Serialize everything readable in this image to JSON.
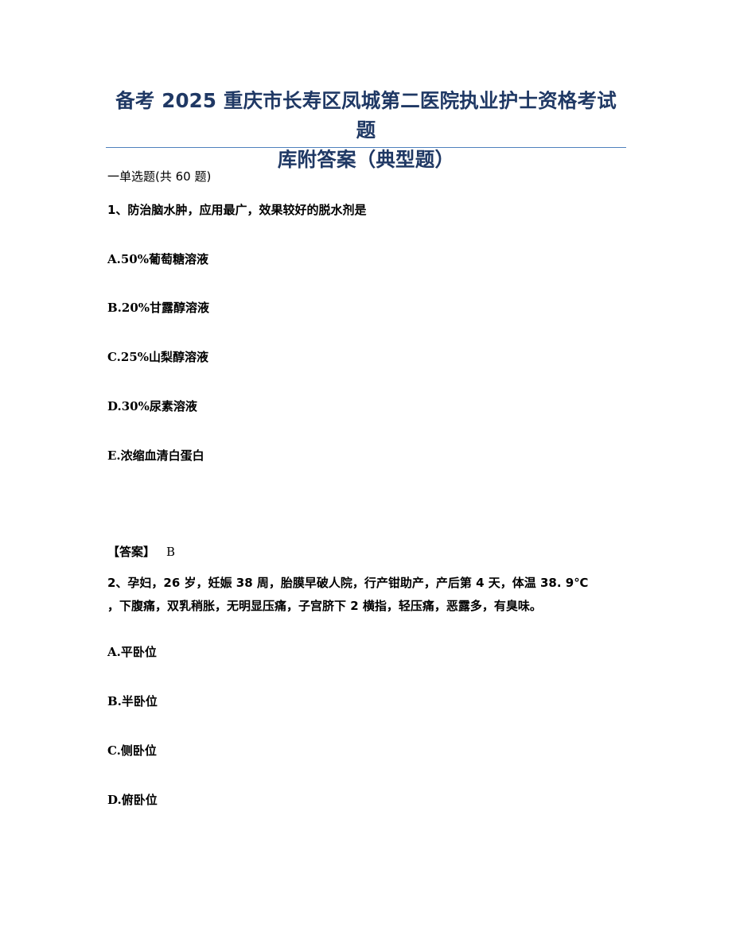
{
  "document": {
    "title_line1": "备考 2025 重庆市长寿区凤城第二医院执业护士资格考试题",
    "title_line2": "库附答案（典型题）",
    "section_heading": "一单选题(共 60 题)"
  },
  "questions": [
    {
      "text": "1、防治脑水肿，应用最广，效果较好的脱水剂是",
      "options": [
        "A.50%葡萄糖溶液",
        "B.20%甘露醇溶液",
        "C.25%山梨醇溶液",
        "D.30%尿素溶液",
        "E.浓缩血清白蛋白"
      ],
      "answer_label": "【答案】",
      "answer_value": "B"
    },
    {
      "text_line1": "2、孕妇，26 岁，妊娠 38 周，胎膜早破人院，行产钳助产，产后第 4 天，体温 38. 9℃",
      "text_line2": "，下腹痛，双乳稍胀，无明显压痛，子宫脐下 2 横指，轻压痛，恶露多，有臭味。",
      "options": [
        "A.平卧位",
        "B.半卧位",
        "C.侧卧位",
        "D.俯卧位"
      ]
    }
  ],
  "colors": {
    "title": "#1f3864",
    "rule": "#4f81bd",
    "text": "#000000"
  }
}
